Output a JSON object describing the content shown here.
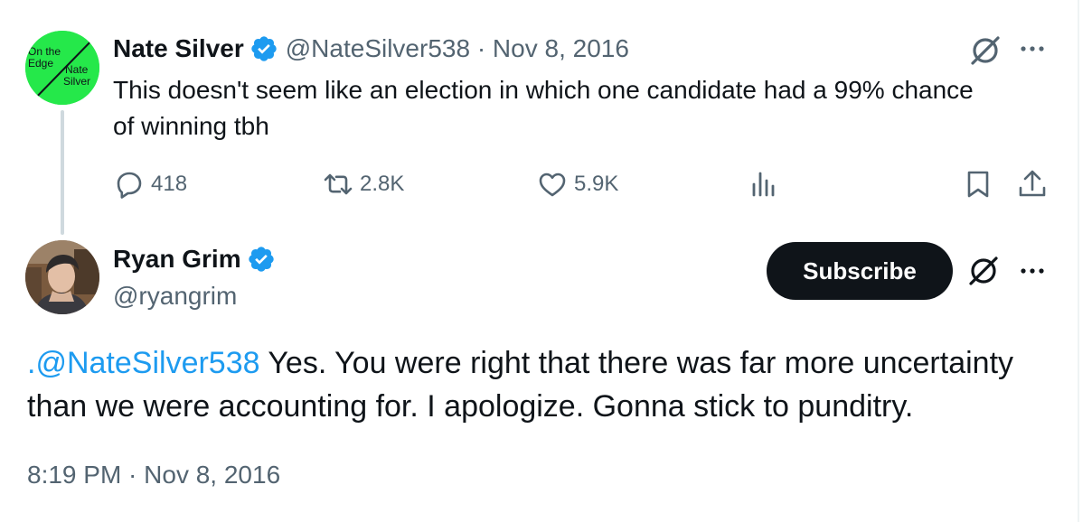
{
  "parent": {
    "name": "Nate Silver",
    "handle_date": "@NateSilver538 · Nov 8, 2016",
    "text": "This doesn't seem like an election in which one candidate had a 99% chance of winning tbh",
    "avatar": {
      "line1": "On the",
      "line2": "Edge",
      "line3": "Nate",
      "line4": "Silver",
      "bg_color": "#25e84a"
    },
    "metrics": {
      "replies": "418",
      "reposts": "2.8K",
      "likes": "5.9K"
    }
  },
  "reply": {
    "name": "Ryan Grim",
    "handle": "@ryangrim",
    "subscribe_label": "Subscribe",
    "mention": ".@NateSilver538",
    "text": " Yes. You were right that there was far more uncertainty than we were accounting for. I apologize. Gonna stick to punditry.",
    "timestamp": "8:19 PM · Nov 8, 2016"
  },
  "colors": {
    "verified": "#1d9bf0",
    "link": "#1d9bf0",
    "secondary_text": "#536471",
    "button_bg": "#0f1419"
  },
  "icons": [
    "verified-badge-icon",
    "grok-icon",
    "more-icon",
    "reply-icon",
    "repost-icon",
    "like-icon",
    "views-icon",
    "bookmark-icon",
    "share-icon"
  ]
}
